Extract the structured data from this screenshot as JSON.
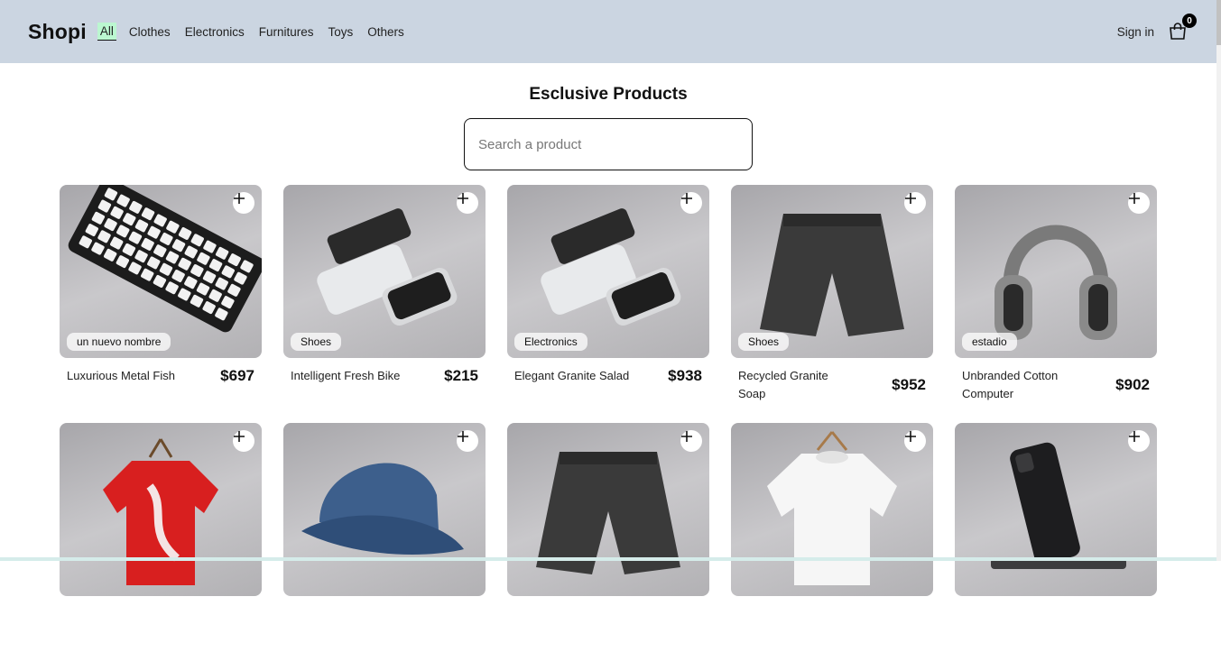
{
  "nav": {
    "brand": "Shopi",
    "links": [
      "All",
      "Clothes",
      "Electronics",
      "Furnitures",
      "Toys",
      "Others"
    ],
    "signin": "Sign in",
    "cart_count": "0"
  },
  "main": {
    "title": "Esclusive Products",
    "search_placeholder": "Search a product"
  },
  "products": [
    {
      "name": "Luxurious Metal Fish",
      "price": "$697",
      "category": "un nuevo nombre",
      "image": "keyboard"
    },
    {
      "name": "Intelligent Fresh Bike",
      "price": "$215",
      "category": "Shoes",
      "image": "devices"
    },
    {
      "name": "Elegant Granite Salad",
      "price": "$938",
      "category": "Electronics",
      "image": "devices"
    },
    {
      "name": "Recycled Granite Soap",
      "price": "$952",
      "category": "Shoes",
      "image": "shorts"
    },
    {
      "name": "Unbranded Cotton Computer",
      "price": "$902",
      "category": "estadio",
      "image": "headphones"
    },
    {
      "name": "",
      "price": "",
      "category": "",
      "image": "red-shirt"
    },
    {
      "name": "",
      "price": "",
      "category": "",
      "image": "cap"
    },
    {
      "name": "",
      "price": "",
      "category": "",
      "image": "shorts"
    },
    {
      "name": "",
      "price": "",
      "category": "",
      "image": "white-shirt"
    },
    {
      "name": "",
      "price": "",
      "category": "",
      "image": "phone"
    }
  ],
  "icons": {
    "add": "plus-icon",
    "cart": "shopping-bag-icon"
  }
}
